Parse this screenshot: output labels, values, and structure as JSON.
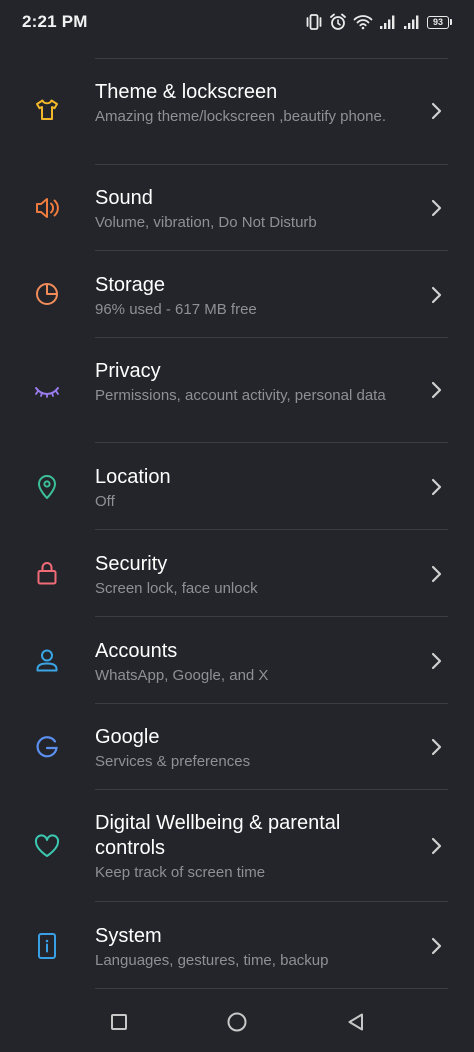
{
  "status_bar": {
    "time": "2:21 PM",
    "battery_level": "93",
    "icons": [
      "vibrate-icon",
      "alarm-icon",
      "wifi-icon",
      "signal-icon",
      "signal-icon",
      "battery-icon"
    ]
  },
  "colors": {
    "background": "#23252a",
    "divider": "#3a3d43",
    "subtitle": "#8e9096",
    "theme_icon": "#f3b72a",
    "sound_icon": "#f07b3f",
    "storage_icon": "#f08b5a",
    "privacy_icon": "#9b7cf0",
    "location_icon": "#3cbf9a",
    "security_icon": "#f06a78",
    "accounts_icon": "#3ba6e6",
    "google_icon": "#5b8ff0",
    "wellbeing_icon": "#3cc7b0",
    "system_icon": "#3aa0e6"
  },
  "settings": {
    "items": [
      {
        "title": "Theme & lockscreen",
        "subtitle": "Amazing theme/lockscreen ,beautify phone.",
        "icon": "tshirt-icon"
      },
      {
        "title": "Sound",
        "subtitle": "Volume, vibration, Do Not Disturb",
        "icon": "speaker-icon"
      },
      {
        "title": "Storage",
        "subtitle": "96% used - 617 MB free",
        "icon": "pie-chart-icon"
      },
      {
        "title": "Privacy",
        "subtitle": "Permissions, account activity, personal data",
        "icon": "eye-closed-icon"
      },
      {
        "title": "Location",
        "subtitle": "Off",
        "icon": "location-pin-icon"
      },
      {
        "title": "Security",
        "subtitle": "Screen lock, face unlock",
        "icon": "lock-icon"
      },
      {
        "title": "Accounts",
        "subtitle": "WhatsApp, Google, and X",
        "icon": "person-icon"
      },
      {
        "title": "Google",
        "subtitle": "Services & preferences",
        "icon": "google-g-icon"
      },
      {
        "title": "Digital Wellbeing & parental controls",
        "subtitle": "Keep track of screen time",
        "icon": "heart-icon"
      },
      {
        "title": "System",
        "subtitle": "Languages, gestures, time, backup",
        "icon": "info-phone-icon"
      }
    ]
  },
  "nav_bar": {
    "buttons": [
      "recents-button",
      "home-button",
      "back-button"
    ]
  }
}
